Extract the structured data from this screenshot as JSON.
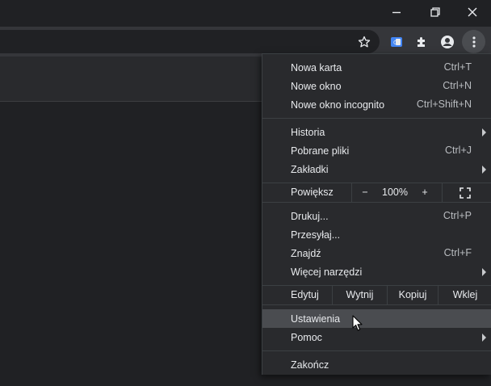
{
  "window_controls": {
    "minimize_icon": "minimize-icon",
    "restore_icon": "restore-icon",
    "close_icon": "close-icon"
  },
  "toolbar": {
    "icons": [
      "star-icon",
      "translate-extension-icon",
      "puzzle-extensions-icon",
      "profile-avatar-icon",
      "kebab-menu-icon"
    ]
  },
  "menu": {
    "new_tab": {
      "label": "Nowa karta",
      "shortcut": "Ctrl+T"
    },
    "new_window": {
      "label": "Nowe okno",
      "shortcut": "Ctrl+N"
    },
    "new_incognito": {
      "label": "Nowe okno incognito",
      "shortcut": "Ctrl+Shift+N"
    },
    "history": {
      "label": "Historia"
    },
    "downloads": {
      "label": "Pobrane pliki",
      "shortcut": "Ctrl+J"
    },
    "bookmarks": {
      "label": "Zakładki"
    },
    "zoom": {
      "label": "Powiększ",
      "minus": "−",
      "value": "100%",
      "plus": "+"
    },
    "print": {
      "label": "Drukuj...",
      "shortcut": "Ctrl+P"
    },
    "cast": {
      "label": "Przesyłaj..."
    },
    "find": {
      "label": "Znajdź",
      "shortcut": "Ctrl+F"
    },
    "more_tools": {
      "label": "Więcej narzędzi"
    },
    "edit": {
      "label": "Edytuj",
      "cut": "Wytnij",
      "copy": "Kopiuj",
      "paste": "Wklej"
    },
    "settings": {
      "label": "Ustawienia"
    },
    "help": {
      "label": "Pomoc"
    },
    "exit": {
      "label": "Zakończ"
    }
  },
  "colors": {
    "background": "#202124",
    "toolbar": "#35363a",
    "menu": "#292a2d",
    "hover": "#4a4c50",
    "accent_extension": "#4285f4"
  }
}
